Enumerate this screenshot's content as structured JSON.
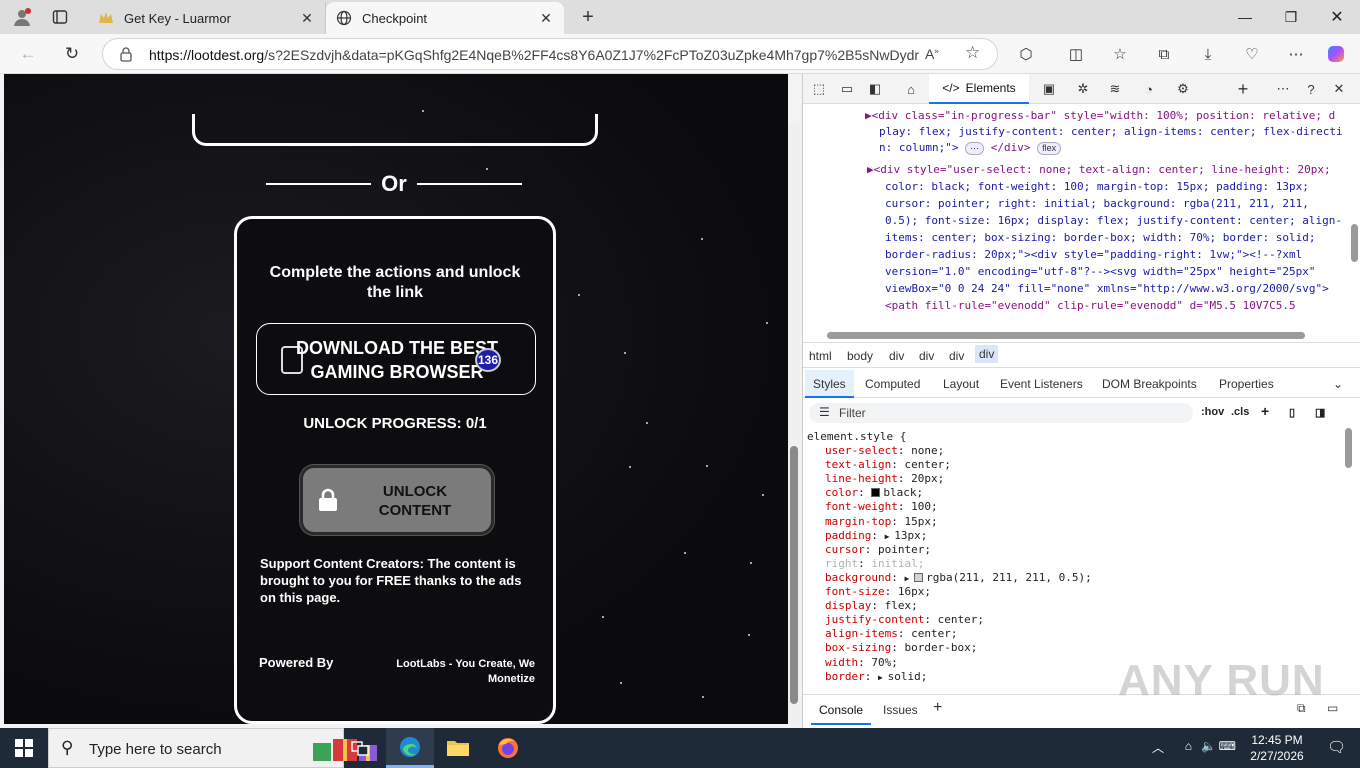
{
  "browser": {
    "tabs": [
      {
        "label": "Get Key - Luarmor",
        "active": false
      },
      {
        "label": "Checkpoint",
        "active": true
      }
    ],
    "url_host": "https://lootdest.org",
    "url_rest": "/s?2ESzdvjh&data=pKGqShfg2E4NqeB%2FF4cs8Y6A0Z1J7%2FcPToZ03uZpke4Mh7gp7%2B5sNwDydr..."
  },
  "page": {
    "or_label": "Or",
    "card_title": "Complete the actions and unlock the link",
    "action_label": "DOWNLOAD THE BEST GAMING BROWSER",
    "action_badge": "136",
    "progress": "UNLOCK PROGRESS: 0/1",
    "unlock_label": "UNLOCK CONTENT",
    "support_text": "Support Content Creators: The content is brought to you for FREE thanks to the ads on this page.",
    "powered_by": "Powered By",
    "lootlabs": "LootLabs - You Create, We Monetize"
  },
  "devtools": {
    "active_tab": "Elements",
    "dom_lines": [
      "▶<div class=\"in-progress-bar\" style=\"width: 100%; position: relative; d",
      "play: flex; justify-content: center; align-items: center; flex-directi",
      "n: column;\">",
      "▶<div style=\"user-select: none; text-align: center; line-height: 20px;",
      "color: black; font-weight: 100; margin-top: 15px; padding: 13px;",
      "cursor: pointer; right: initial; background: rgba(211, 211, 211,",
      "0.5); font-size: 16px; display: flex; justify-content: center; align-",
      "items: center; box-sizing: border-box; width: 70%; border: solid;",
      "border-radius: 20px;\"><div style=\"padding-right: 1vw;\"><!--?xml",
      "version=\"1.0\" encoding=\"utf-8\"?--><svg width=\"25px\" height=\"25px\"",
      "viewBox=\"0 0 24 24\" fill=\"none\" xmlns=\"http://www.w3.org/2000/svg\">",
      "<path fill-rule=\"evenodd\" clip-rule=\"evenodd\" d=\"M5.5 10V7C5.5"
    ],
    "dom_pill": "flex",
    "breadcrumb": [
      "html",
      "body",
      "div",
      "div",
      "div",
      "div"
    ],
    "sub_tabs": [
      "Styles",
      "Computed",
      "Layout",
      "Event Listeners",
      "DOM Breakpoints",
      "Properties"
    ],
    "filter_placeholder": "Filter",
    "filter_tools": [
      ":hov",
      ".cls"
    ],
    "element_style_selector": "element.style {",
    "style_props": [
      {
        "name": "user-select",
        "value": "none;"
      },
      {
        "name": "text-align",
        "value": "center;"
      },
      {
        "name": "line-height",
        "value": "20px;"
      },
      {
        "name": "color",
        "value": "black;"
      },
      {
        "name": "font-weight",
        "value": "100;"
      },
      {
        "name": "margin-top",
        "value": "15px;"
      },
      {
        "name": "padding",
        "value": "13px;"
      },
      {
        "name": "cursor",
        "value": "pointer;"
      },
      {
        "name": "right",
        "value": "initial;"
      },
      {
        "name": "background",
        "value": "rgba(211, 211, 211, 0.5);"
      },
      {
        "name": "font-size",
        "value": "16px;"
      },
      {
        "name": "display",
        "value": "flex;"
      },
      {
        "name": "justify-content",
        "value": "center;"
      },
      {
        "name": "align-items",
        "value": "center;"
      },
      {
        "name": "box-sizing",
        "value": "border-box;"
      },
      {
        "name": "width",
        "value": "70%;"
      },
      {
        "name": "border",
        "value": "solid;"
      }
    ],
    "console_tabs": [
      "Console",
      "Issues"
    ]
  },
  "watermark": "ANY RUN",
  "taskbar": {
    "search_placeholder": "Type here to search",
    "time": "12:45 PM",
    "date": "2/27/2026"
  }
}
